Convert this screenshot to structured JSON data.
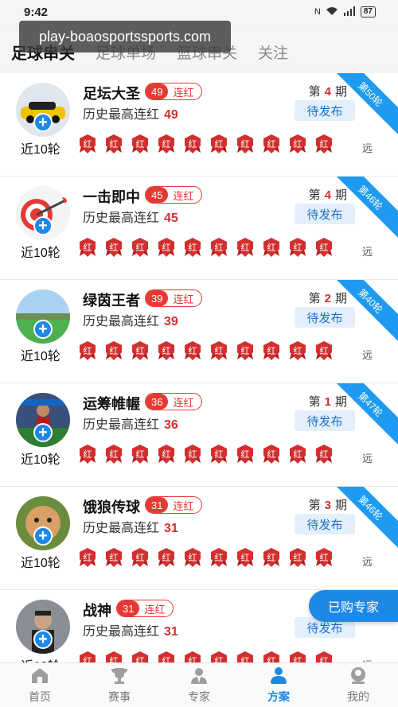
{
  "status": {
    "time": "9:42",
    "battery": "87"
  },
  "url": "play-boaosportssports.com",
  "tabs": [
    {
      "label": "足球串关",
      "active": true
    },
    {
      "label": "足球单场",
      "active": false
    },
    {
      "label": "篮球串关",
      "active": false
    },
    {
      "label": "关注",
      "active": false
    }
  ],
  "cards": [
    {
      "name": "足坛大圣",
      "streak": "49",
      "streak_label": "连红",
      "history_label": "历史最高连红",
      "history_value": "49",
      "period_prefix": "第",
      "period": "4",
      "period_suffix": "期",
      "pending": "待发布",
      "ribbon": "第50轮",
      "recent_label": "近10轮",
      "far": "远",
      "badge": "红",
      "avatar": "car"
    },
    {
      "name": "一击即中",
      "streak": "45",
      "streak_label": "连红",
      "history_label": "历史最高连红",
      "history_value": "45",
      "period_prefix": "第",
      "period": "4",
      "period_suffix": "期",
      "pending": "待发布",
      "ribbon": "第46轮",
      "recent_label": "近10轮",
      "far": "远",
      "badge": "红",
      "avatar": "dart"
    },
    {
      "name": "绿茵王者",
      "streak": "39",
      "streak_label": "连红",
      "history_label": "历史最高连红",
      "history_value": "39",
      "period_prefix": "第",
      "period": "2",
      "period_suffix": "期",
      "pending": "待发布",
      "ribbon": "第40轮",
      "recent_label": "近10轮",
      "far": "远",
      "badge": "红",
      "avatar": "field"
    },
    {
      "name": "运筹帷幄",
      "streak": "36",
      "streak_label": "连红",
      "history_label": "历史最高连红",
      "history_value": "36",
      "period_prefix": "第",
      "period": "1",
      "period_suffix": "期",
      "pending": "待发布",
      "ribbon": "第47轮",
      "recent_label": "近10轮",
      "far": "远",
      "badge": "红",
      "avatar": "player"
    },
    {
      "name": "饿狼传球",
      "streak": "31",
      "streak_label": "连红",
      "history_label": "历史最高连红",
      "history_value": "31",
      "period_prefix": "第",
      "period": "3",
      "period_suffix": "期",
      "pending": "待发布",
      "ribbon": "第46轮",
      "recent_label": "近10轮",
      "far": "远",
      "badge": "红",
      "avatar": "face"
    },
    {
      "name": "战神",
      "streak": "31",
      "streak_label": "连红",
      "history_label": "历史最高连红",
      "history_value": "31",
      "period_prefix": "第",
      "period": "",
      "period_suffix": "",
      "pending": "待发布",
      "ribbon": "",
      "recent_label": "近10轮",
      "far": "远",
      "badge": "红",
      "avatar": "man"
    }
  ],
  "floating_button": "已购专家",
  "nav": [
    {
      "label": "首页",
      "icon": "home-icon",
      "active": false
    },
    {
      "label": "赛事",
      "icon": "trophy-icon",
      "active": false
    },
    {
      "label": "专家",
      "icon": "expert-icon",
      "active": false
    },
    {
      "label": "方案",
      "icon": "plan-icon",
      "active": true
    },
    {
      "label": "我的",
      "icon": "profile-icon",
      "active": false
    }
  ],
  "colors": {
    "accent": "#1e88e5",
    "red": "#e53935",
    "ribbon": "#1e9bf0"
  }
}
